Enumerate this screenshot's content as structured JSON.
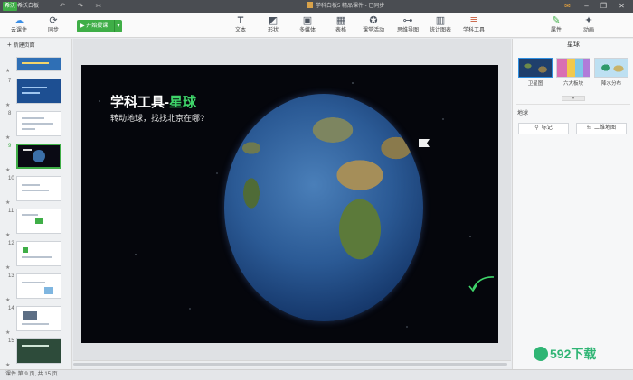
{
  "app": {
    "badge": "希沃",
    "name": "希沃白板",
    "document_title": "学科白板5 精品课件 - 已同步"
  },
  "toolbar": {
    "cloud_label": "云课件",
    "sync_label": "同步",
    "start_label": "开始授课",
    "tools": [
      "文本",
      "形状",
      "多媒体",
      "表格",
      "课堂活动",
      "思维导图",
      "统计图表",
      "学科工具"
    ],
    "right_tools": [
      "属性",
      "动画"
    ]
  },
  "left_panel": {
    "new_page_label": "新建页面",
    "thumbnails": [
      "",
      "7",
      "8",
      "9",
      "10",
      "11",
      "12",
      "13",
      "14",
      "15"
    ],
    "selected": "9"
  },
  "slide": {
    "title_main": "学科工具-",
    "title_accent": "星球",
    "subtitle": "转动地球，找找北京在哪?"
  },
  "right_panel": {
    "header": "星球",
    "map_options": [
      "卫星图",
      "六大板块",
      "降水分布"
    ],
    "section_label": "地球",
    "mark_button": "标记",
    "map2d_button": "二维地图"
  },
  "status": {
    "text": "课件 第 9 页, 共 15 页"
  },
  "watermark": "592下载"
}
